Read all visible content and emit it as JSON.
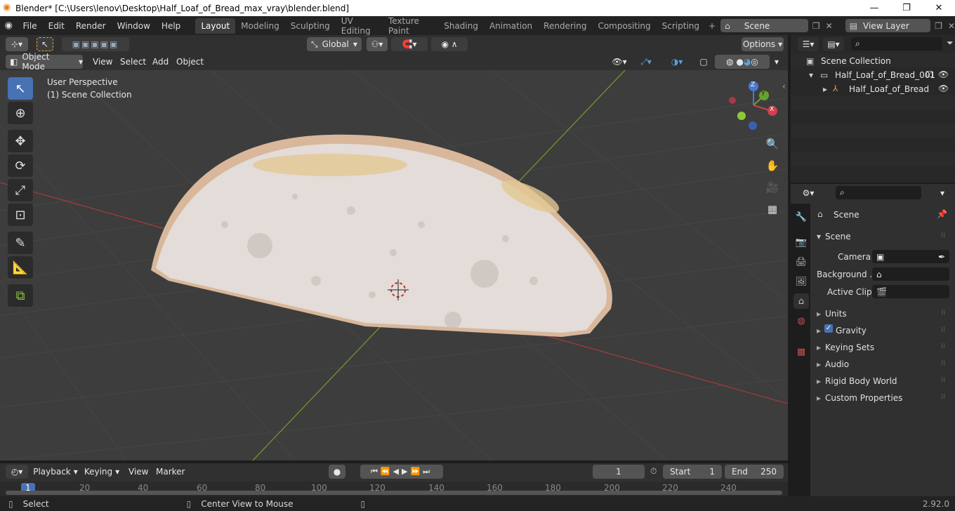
{
  "window": {
    "title": "Blender* [C:\\Users\\lenov\\Desktop\\Half_Loaf_of_Bread_max_vray\\blender.blend]",
    "minimize": "—",
    "maximize": "❐",
    "close": "✕"
  },
  "menus": [
    "File",
    "Edit",
    "Render",
    "Window",
    "Help"
  ],
  "workspaces": [
    "Layout",
    "Modeling",
    "Sculpting",
    "UV Editing",
    "Texture Paint",
    "Shading",
    "Animation",
    "Rendering",
    "Compositing",
    "Scripting"
  ],
  "scene_field": "Scene",
  "view_layer_field": "View Layer",
  "toolheader": {
    "transform": "Global",
    "options": "Options"
  },
  "viewport_header": {
    "mode": "Object Mode",
    "menus": [
      "View",
      "Select",
      "Add",
      "Object"
    ]
  },
  "viewport": {
    "perspective": "User Perspective",
    "collection": "(1) Scene Collection"
  },
  "gizmo": {
    "z": "Z",
    "y": "Y",
    "x": "X"
  },
  "outliner": {
    "root": "Scene Collection",
    "items": [
      {
        "label": "Half_Loaf_of_Bread_001"
      },
      {
        "label": "Half_Loaf_of_Bread"
      }
    ]
  },
  "properties": {
    "context": "Scene",
    "panel": "Scene",
    "fields": [
      {
        "label": "Camera"
      },
      {
        "label": "Background ..."
      },
      {
        "label": "Active Clip"
      }
    ],
    "collapsed_panels": [
      "Units",
      "Gravity",
      "Keying Sets",
      "Audio",
      "Rigid Body World",
      "Custom Properties"
    ],
    "gravity_checked": true
  },
  "timeline": {
    "menus": [
      "Playback",
      "Keying",
      "View",
      "Marker"
    ],
    "current_frame": "1",
    "start_label": "Start",
    "start": "1",
    "end_label": "End",
    "end": "250",
    "ruler": [
      "1",
      "20",
      "40",
      "60",
      "80",
      "100",
      "120",
      "140",
      "160",
      "180",
      "200",
      "220",
      "240"
    ]
  },
  "status": {
    "left": "Select",
    "middle": "Center View to Mouse",
    "version": "2.92.0"
  }
}
